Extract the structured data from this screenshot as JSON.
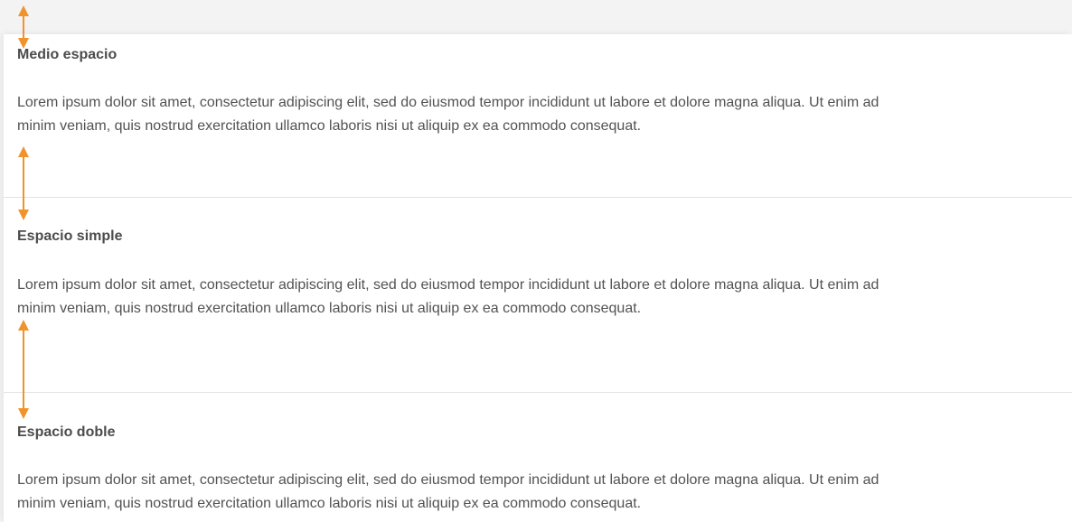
{
  "sections": [
    {
      "title": "Medio espacio",
      "lines": [
        "Lorem ipsum dolor sit amet, consectetur adipiscing elit, sed do eiusmod tempor incididunt ut labore et dolore magna aliqua. Ut enim ad",
        "minim veniam, quis nostrud exercitation ullamco laboris nisi ut aliquip ex ea commodo consequat."
      ]
    },
    {
      "title": "Espacio simple",
      "lines": [
        "Lorem ipsum dolor sit amet, consectetur adipiscing elit, sed do eiusmod tempor incididunt ut labore et dolore magna aliqua. Ut enim ad",
        "minim veniam, quis nostrud exercitation ullamco laboris nisi ut aliquip ex ea commodo consequat."
      ]
    },
    {
      "title": "Espacio doble",
      "lines": [
        "Lorem ipsum dolor sit amet, consectetur adipiscing elit, sed do eiusmod tempor incididunt ut labore et dolore magna aliqua. Ut enim ad",
        "minim veniam, quis nostrud exercitation ullamco laboris nisi ut aliquip ex ea commodo consequat."
      ]
    }
  ],
  "colors": {
    "accent": "#f0932b",
    "divider": "#e3e3e3",
    "text": "#525252",
    "heading": "#4c4c4c",
    "background": "#f3f3f4"
  },
  "icons": [
    "double-arrow-icon"
  ]
}
